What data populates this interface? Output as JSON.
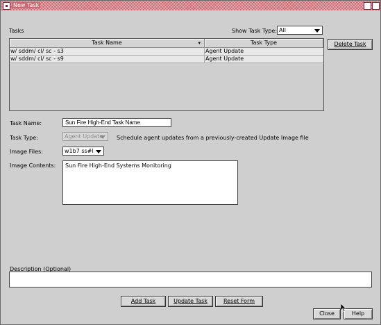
{
  "window": {
    "title": "New Task"
  },
  "tasks_label": "Tasks",
  "show_task_type": {
    "label": "Show Task Type:",
    "value": "All"
  },
  "table": {
    "columns": [
      "Task Name",
      "Task Type"
    ],
    "rows": [
      {
        "name": "w/ sddm/ cl/ sc - s3",
        "type": "Agent Update"
      },
      {
        "name": "w/ sddm/ cl/ sc - s9",
        "type": "Agent Update"
      }
    ]
  },
  "delete_task_button": "Delete Task",
  "task_name": {
    "label": "Task Name:",
    "value": "Sun Fire High-End Task Name"
  },
  "task_type": {
    "label": "Task Type:",
    "value": "Agent Update",
    "description": "Schedule agent updates from a previously-created Update Image file"
  },
  "image_files": {
    "label": "Image Files:",
    "value": "w1b7 ss#l"
  },
  "image_contents": {
    "label": "Image Contents:",
    "value": "Sun Fire High-End Systems Monitoring"
  },
  "description": {
    "label": "Description (Optional)",
    "value": ""
  },
  "buttons": {
    "add": "Add Task",
    "update": "Update Task",
    "reset": "Reset Form",
    "close": "Close",
    "help": "Help"
  }
}
